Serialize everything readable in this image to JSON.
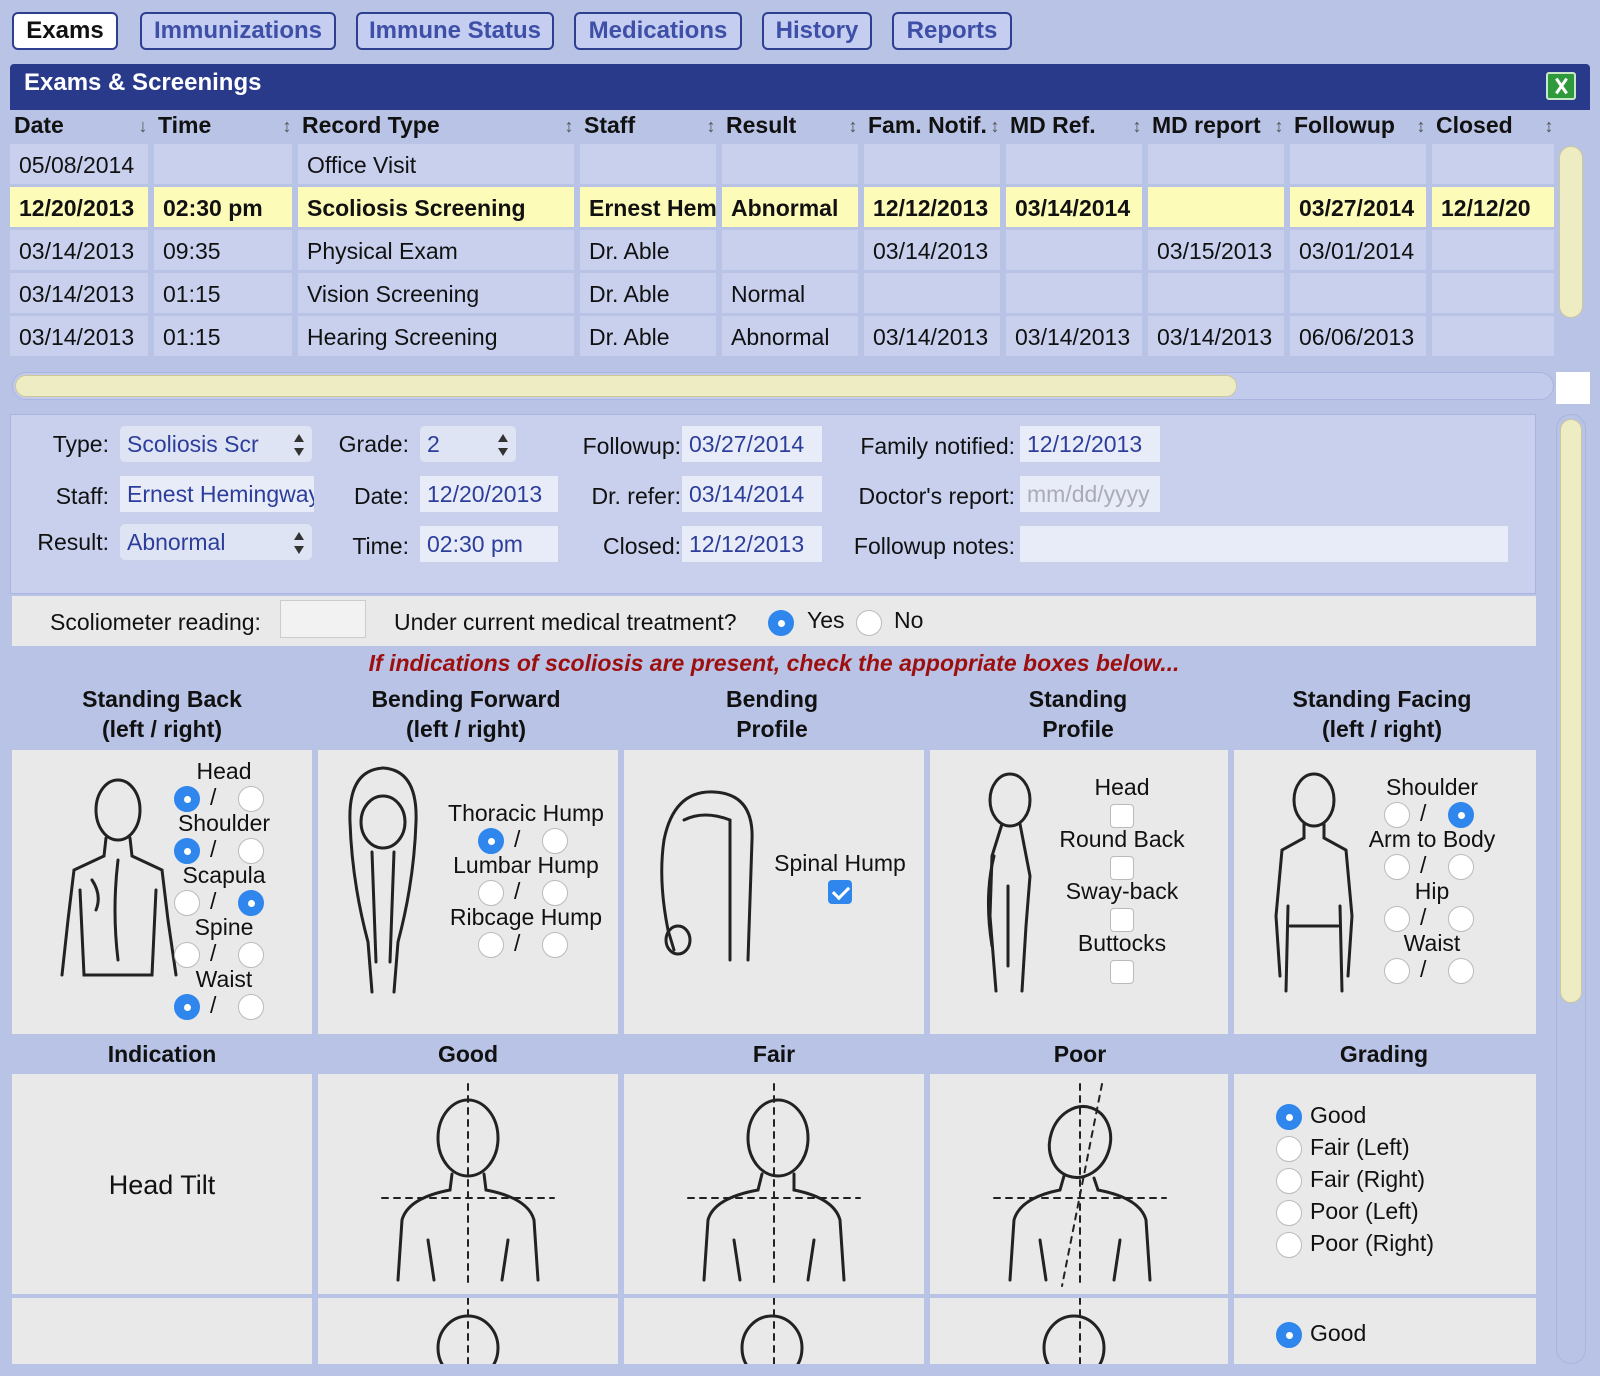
{
  "tabs": [
    "Exams",
    "Immunizations",
    "Immune Status",
    "Medications",
    "History",
    "Reports"
  ],
  "active_tab": "Exams",
  "panel": {
    "title": "Exams & Screenings",
    "export_icon": "excel-icon"
  },
  "grid": {
    "columns": [
      "Date",
      "Time",
      "Record Type",
      "Staff",
      "Result",
      "Fam. Notif.",
      "MD Ref.",
      "MD report",
      "Followup",
      "Closed"
    ],
    "rows": [
      [
        "05/08/2014",
        "",
        "Office Visit",
        "",
        "",
        "",
        "",
        "",
        "",
        ""
      ],
      [
        "12/20/2013",
        "02:30 pm",
        "Scoliosis Screening",
        "Ernest Hem",
        "Abnormal",
        "12/12/2013",
        "03/14/2014",
        "",
        "03/27/2014",
        "12/12/20"
      ],
      [
        "03/14/2013",
        "09:35",
        "Physical Exam",
        "Dr. Able",
        "",
        "03/14/2013",
        "",
        "03/15/2013",
        "03/01/2014",
        ""
      ],
      [
        "03/14/2013",
        "01:15",
        "Vision Screening",
        "Dr. Able",
        "Normal",
        "",
        "",
        "",
        "",
        ""
      ],
      [
        "03/14/2013",
        "01:15",
        "Hearing Screening",
        "Dr. Able",
        "Abnormal",
        "03/14/2013",
        "03/14/2013",
        "03/14/2013",
        "06/06/2013",
        ""
      ]
    ],
    "selected_row": 1,
    "sort_icons": {
      "date": "↓",
      "other": "↕"
    }
  },
  "form": {
    "type_label": "Type:",
    "type_value": "Scoliosis Scr",
    "grade_label": "Grade:",
    "grade_value": "2",
    "followup_label": "Followup:",
    "followup_value": "03/27/2014",
    "family_label": "Family notified:",
    "family_value": "12/12/2013",
    "staff_label": "Staff:",
    "staff_value": "Ernest Hemingway",
    "date_label": "Date:",
    "date_value": "12/20/2013",
    "drrefer_label": "Dr. refer:",
    "drrefer_value": "03/14/2014",
    "docreport_label": "Doctor's report:",
    "docreport_placeholder": "mm/dd/yyyy",
    "result_label": "Result:",
    "result_value": "Abnormal",
    "time_label": "Time:",
    "time_value": "02:30 pm",
    "closed_label": "Closed:",
    "closed_value": "12/12/2013",
    "notes_label": "Followup notes:",
    "notes_value": ""
  },
  "scoliometer": {
    "label": "Scoliometer reading:",
    "value": "",
    "treatment_question": "Under current medical treatment?",
    "yes": "Yes",
    "no": "No",
    "treatment": "Yes"
  },
  "indication_note": "If indications of scoliosis are present, check the appopriate boxes below...",
  "sections": {
    "standing_back": {
      "title1": "Standing Back",
      "title2": "(left / right)",
      "items": [
        {
          "label": "Head",
          "left": true,
          "right": false
        },
        {
          "label": "Shoulder",
          "left": true,
          "right": false
        },
        {
          "label": "Scapula",
          "left": false,
          "right": true
        },
        {
          "label": "Spine",
          "left": false,
          "right": false
        },
        {
          "label": "Waist",
          "left": true,
          "right": false
        }
      ]
    },
    "bending_forward": {
      "title1": "Bending Forward",
      "title2": "(left / right)",
      "items": [
        {
          "label": "Thoracic Hump",
          "left": true,
          "right": false
        },
        {
          "label": "Lumbar Hump",
          "left": false,
          "right": false
        },
        {
          "label": "Ribcage Hump",
          "left": false,
          "right": false
        }
      ]
    },
    "bending_profile": {
      "title1": "Bending",
      "title2": "Profile",
      "items": [
        {
          "label": "Spinal Hump",
          "checked": true
        }
      ]
    },
    "standing_profile": {
      "title1": "Standing",
      "title2": "Profile",
      "items": [
        {
          "label": "Head",
          "checked": false
        },
        {
          "label": "Round Back",
          "checked": false
        },
        {
          "label": "Sway-back",
          "checked": false
        },
        {
          "label": "Buttocks",
          "checked": false
        }
      ]
    },
    "standing_facing": {
      "title1": "Standing Facing",
      "title2": "(left / right)",
      "items": [
        {
          "label": "Shoulder",
          "left": false,
          "right": true
        },
        {
          "label": "Arm to Body",
          "left": false,
          "right": false
        },
        {
          "label": "Hip",
          "left": false,
          "right": false
        },
        {
          "label": "Waist",
          "left": false,
          "right": false
        }
      ]
    },
    "slash": "/"
  },
  "grading": {
    "headers": [
      "Indication",
      "Good",
      "Fair",
      "Poor",
      "Grading"
    ],
    "rows": [
      {
        "indication": "Head Tilt",
        "options": [
          "Good",
          "Fair (Left)",
          "Fair (Right)",
          "Poor (Left)",
          "Poor (Right)"
        ],
        "selected": "Good"
      },
      {
        "indication": "",
        "options": [
          "Good"
        ],
        "selected": "Good"
      }
    ]
  }
}
